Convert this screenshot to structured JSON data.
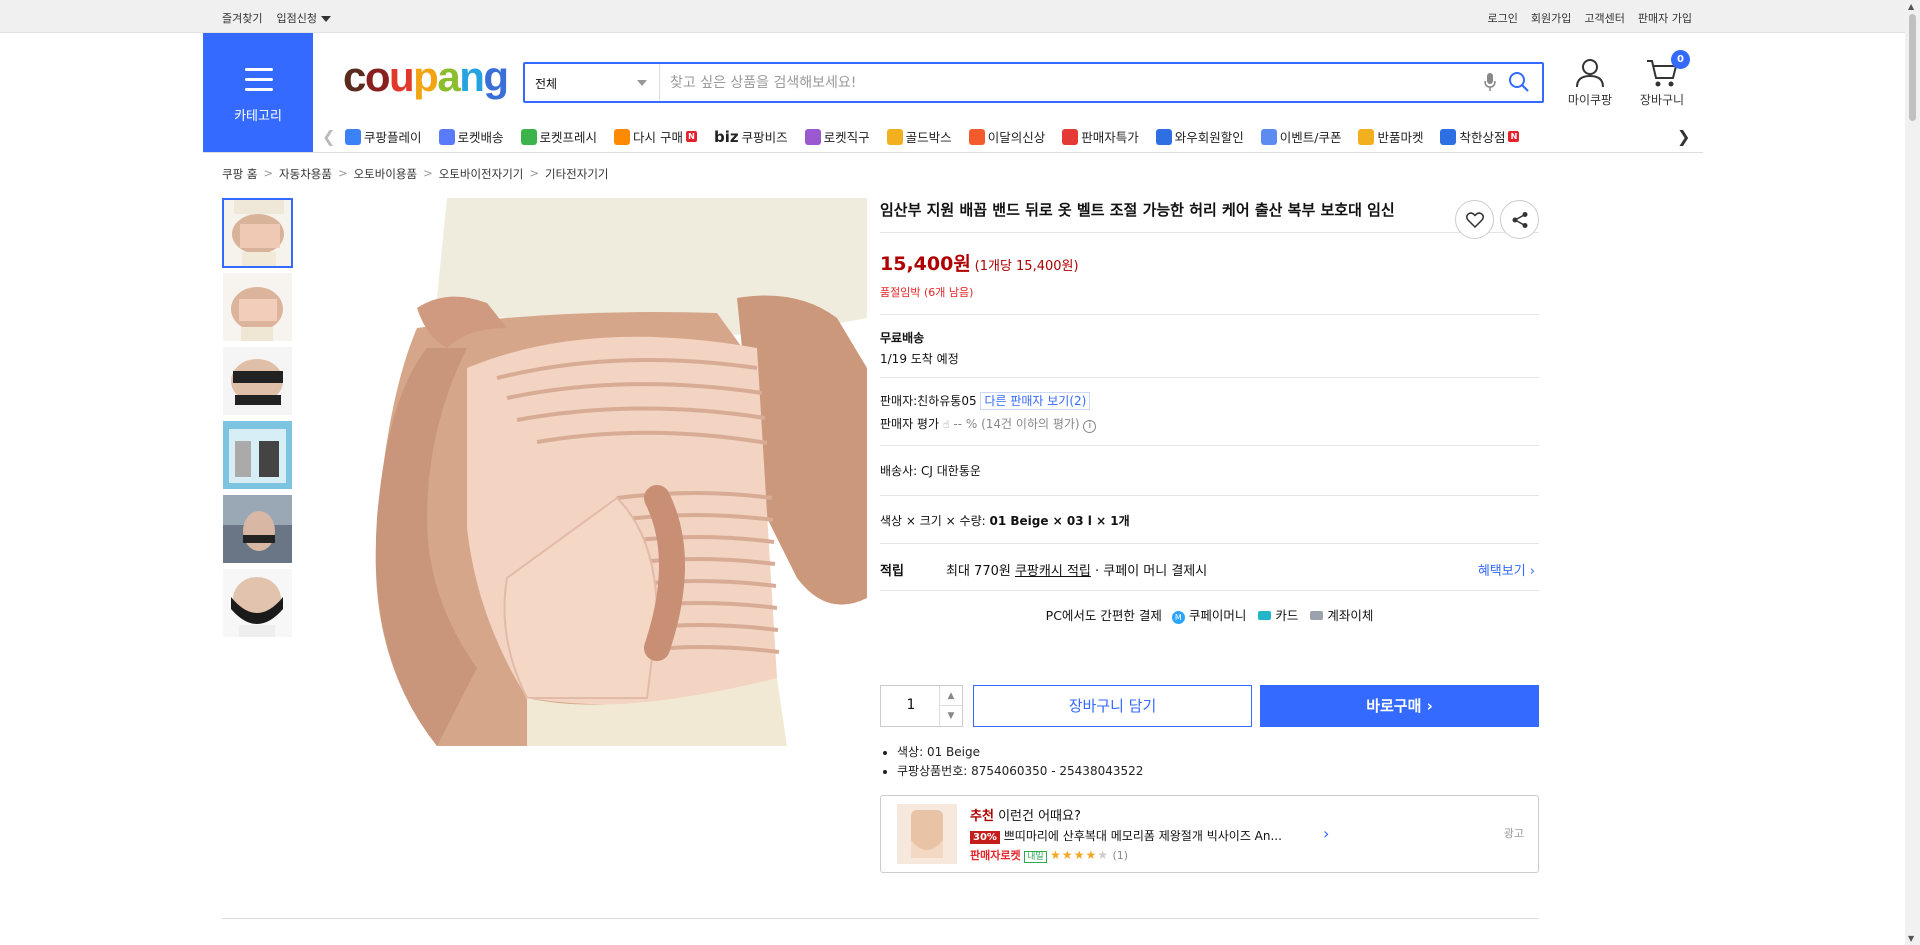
{
  "topbar": {
    "favorites": "즐겨찾기",
    "seller_apply": "입점신청",
    "login": "로그인",
    "signup": "회원가입",
    "customer_center": "고객센터",
    "seller_signup": "판매자 가입"
  },
  "header": {
    "category_label": "카테고리",
    "search_scope": "전체",
    "search_placeholder": "찾고 싶은 상품을 검색해보세요!",
    "mycoupang": "마이쿠팡",
    "cart": "장바구니",
    "cart_count": "0"
  },
  "nav": {
    "items": [
      {
        "label": "쿠팡플레이",
        "icon": "play-icon"
      },
      {
        "label": "로켓배송",
        "icon": "rocket-icon"
      },
      {
        "label": "로켓프레시",
        "icon": "rocket-fresh-icon"
      },
      {
        "label": "다시 구매",
        "icon": "rebuy-icon",
        "badge": "N"
      },
      {
        "label": "쿠팡비즈",
        "prefix": "biz",
        "icon": "biz-icon"
      },
      {
        "label": "로켓직구",
        "icon": "global-icon"
      },
      {
        "label": "골드박스",
        "icon": "goldbox-icon"
      },
      {
        "label": "이달의신상",
        "icon": "new-icon"
      },
      {
        "label": "판매자특가",
        "icon": "discount-icon"
      },
      {
        "label": "와우회원할인",
        "icon": "wow-icon"
      },
      {
        "label": "이벤트/쿠폰",
        "icon": "coupon-icon"
      },
      {
        "label": "반품마켓",
        "icon": "return-market-icon"
      },
      {
        "label": "착한상점",
        "icon": "good-store-icon",
        "badge": "N"
      }
    ]
  },
  "breadcrumb": [
    "쿠팡 홈",
    "자동차용품",
    "오토바이용품",
    "오토바이전자기기",
    "기타전자기기"
  ],
  "product": {
    "title": "임산부 지원 배꼽 밴드 뒤로 옷 벨트 조절 가능한 허리 케어 출산 복부 보호대 임신",
    "price": "15,400원",
    "unit_price": "(1개당 15,400원)",
    "stock_notice": "품절임박 (6개 남음)",
    "shipping_title": "무료배송",
    "arrival": "1/19 도착 예정",
    "seller_label": "판매자:",
    "seller_name": "친하유통05",
    "other_sellers": "다른 판매자 보기(2)",
    "seller_rating_label": "판매자 평가",
    "seller_rating_value": "-- %",
    "seller_rating_note": "(14건 이하의 평가)",
    "carrier_label": "배송사:",
    "carrier_name": "CJ 대한통운",
    "option_label": "색상 × 크기 × 수량:",
    "option_value": "01 Beige × 03 l × 1개",
    "reward_label": "적립",
    "reward_text": "최대 770원",
    "reward_link": "쿠팡캐시 적립",
    "reward_suffix": "· 쿠페이 머니 결제시",
    "benefit_link": "혜택보기",
    "pc_pay_label": "PC에서도 간편한 결제",
    "pay_methods": [
      "쿠페이머니",
      "카드",
      "계좌이체"
    ],
    "quantity": "1",
    "add_cart": "장바구니 담기",
    "buy_now": "바로구매",
    "details": [
      "색상: 01 Beige",
      "쿠팡상품번호: 8754060350 - 25438043522"
    ]
  },
  "recommend": {
    "title_highlight": "추천",
    "title_rest": "이런건 어때요?",
    "discount": "30%",
    "name": "쁘띠마리에 산후복대 메모리폼 제왕절개 빅사이즈 An...",
    "tag": "판매자로켓",
    "tag_sub": "내일",
    "rating_count": "(1)",
    "rating": 4,
    "ad_label": "광고"
  }
}
